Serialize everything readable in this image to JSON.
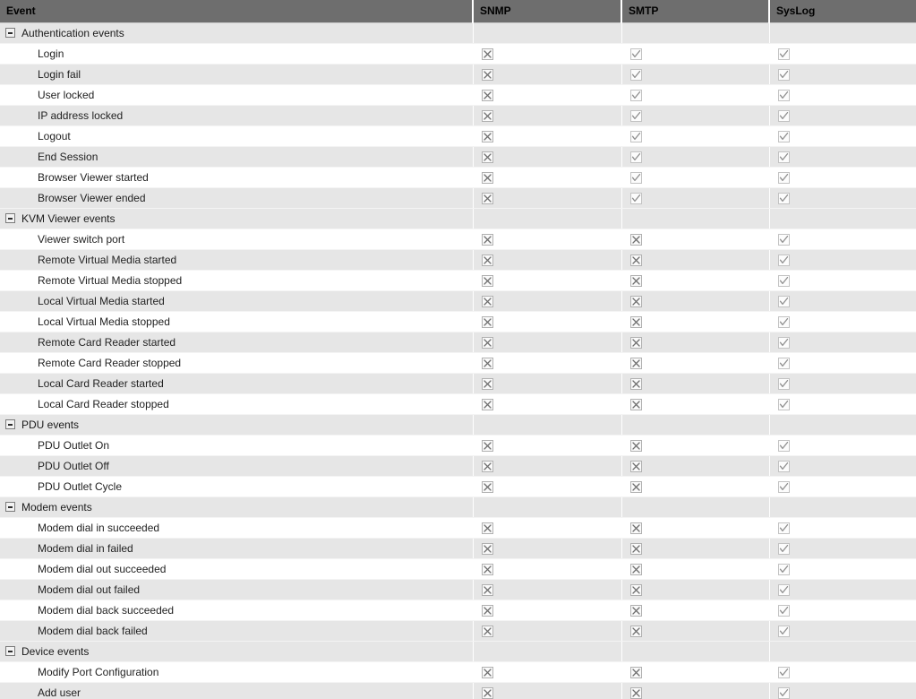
{
  "table": {
    "columns": [
      {
        "key": "event",
        "label": "Event"
      },
      {
        "key": "snmp",
        "label": "SNMP"
      },
      {
        "key": "smtp",
        "label": "SMTP"
      },
      {
        "key": "syslog",
        "label": "SysLog"
      }
    ],
    "expander_icon": "minus-square-icon",
    "state_icons": {
      "cross": "cross-checkbox-icon",
      "check": "check-checkbox-icon",
      "empty": "no-checkbox"
    },
    "colors": {
      "header_background": "#6e6e6e",
      "header_text": "#000000",
      "row_odd": "#ffffff",
      "row_even": "#e6e6e6",
      "group_row": "#e6e6e6",
      "checkbox_border": "#b9b9b9",
      "glyph": "#6f6f6f"
    },
    "groups": [
      {
        "label": "Authentication events",
        "expanded": true,
        "snmp": "empty",
        "smtp": "empty",
        "syslog": "empty",
        "rows": [
          {
            "label": "Login",
            "snmp": "cross",
            "smtp": "check",
            "syslog": "check"
          },
          {
            "label": "Login fail",
            "snmp": "cross",
            "smtp": "check",
            "syslog": "check"
          },
          {
            "label": "User locked",
            "snmp": "cross",
            "smtp": "check",
            "syslog": "check"
          },
          {
            "label": "IP address locked",
            "snmp": "cross",
            "smtp": "check",
            "syslog": "check"
          },
          {
            "label": "Logout",
            "snmp": "cross",
            "smtp": "check",
            "syslog": "check"
          },
          {
            "label": "End Session",
            "snmp": "cross",
            "smtp": "check",
            "syslog": "check"
          },
          {
            "label": "Browser Viewer started",
            "snmp": "cross",
            "smtp": "check",
            "syslog": "check"
          },
          {
            "label": "Browser Viewer ended",
            "snmp": "cross",
            "smtp": "check",
            "syslog": "check"
          }
        ]
      },
      {
        "label": "KVM Viewer events",
        "expanded": true,
        "snmp": "empty",
        "smtp": "empty",
        "syslog": "empty",
        "rows": [
          {
            "label": "Viewer switch port",
            "snmp": "cross",
            "smtp": "cross",
            "syslog": "check"
          },
          {
            "label": "Remote Virtual Media started",
            "snmp": "cross",
            "smtp": "cross",
            "syslog": "check"
          },
          {
            "label": "Remote Virtual Media stopped",
            "snmp": "cross",
            "smtp": "cross",
            "syslog": "check"
          },
          {
            "label": "Local Virtual Media started",
            "snmp": "cross",
            "smtp": "cross",
            "syslog": "check"
          },
          {
            "label": "Local Virtual Media stopped",
            "snmp": "cross",
            "smtp": "cross",
            "syslog": "check"
          },
          {
            "label": "Remote Card Reader started",
            "snmp": "cross",
            "smtp": "cross",
            "syslog": "check"
          },
          {
            "label": "Remote Card Reader stopped",
            "snmp": "cross",
            "smtp": "cross",
            "syslog": "check"
          },
          {
            "label": "Local Card Reader started",
            "snmp": "cross",
            "smtp": "cross",
            "syslog": "check"
          },
          {
            "label": "Local Card Reader stopped",
            "snmp": "cross",
            "smtp": "cross",
            "syslog": "check"
          }
        ]
      },
      {
        "label": "PDU events",
        "expanded": true,
        "snmp": "empty",
        "smtp": "empty",
        "syslog": "empty",
        "rows": [
          {
            "label": "PDU Outlet On",
            "snmp": "cross",
            "smtp": "cross",
            "syslog": "check"
          },
          {
            "label": "PDU Outlet Off",
            "snmp": "cross",
            "smtp": "cross",
            "syslog": "check"
          },
          {
            "label": "PDU Outlet Cycle",
            "snmp": "cross",
            "smtp": "cross",
            "syslog": "check"
          }
        ]
      },
      {
        "label": "Modem events",
        "expanded": true,
        "snmp": "empty",
        "smtp": "empty",
        "syslog": "empty",
        "rows": [
          {
            "label": "Modem dial in succeeded",
            "snmp": "cross",
            "smtp": "cross",
            "syslog": "check"
          },
          {
            "label": "Modem dial in failed",
            "snmp": "cross",
            "smtp": "cross",
            "syslog": "check"
          },
          {
            "label": "Modem dial out succeeded",
            "snmp": "cross",
            "smtp": "cross",
            "syslog": "check"
          },
          {
            "label": "Modem dial out failed",
            "snmp": "cross",
            "smtp": "cross",
            "syslog": "check"
          },
          {
            "label": "Modem dial back succeeded",
            "snmp": "cross",
            "smtp": "cross",
            "syslog": "check"
          },
          {
            "label": "Modem dial back failed",
            "snmp": "cross",
            "smtp": "cross",
            "syslog": "check"
          }
        ]
      },
      {
        "label": "Device events",
        "expanded": true,
        "snmp": "empty",
        "smtp": "empty",
        "syslog": "empty",
        "rows": [
          {
            "label": "Modify Port Configuration",
            "snmp": "cross",
            "smtp": "cross",
            "syslog": "check"
          },
          {
            "label": "Add user",
            "snmp": "cross",
            "smtp": "cross",
            "syslog": "check"
          }
        ]
      }
    ]
  }
}
